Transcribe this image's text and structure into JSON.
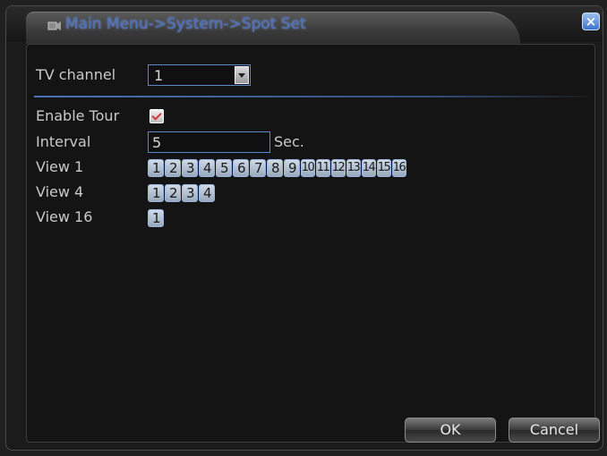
{
  "window": {
    "title": "Main Menu->System->Spot Set",
    "close_glyph": "×"
  },
  "form": {
    "tv_channel": {
      "label": "TV channel",
      "value": "1"
    },
    "enable_tour": {
      "label": "Enable Tour",
      "checked": true
    },
    "interval": {
      "label": "Interval",
      "value": "5",
      "unit": "Sec."
    },
    "view1": {
      "label": "View 1",
      "channels": [
        "1",
        "2",
        "3",
        "4",
        "5",
        "6",
        "7",
        "8",
        "9",
        "10",
        "11",
        "12",
        "13",
        "14",
        "15",
        "16"
      ]
    },
    "view4": {
      "label": "View 4",
      "channels": [
        "1",
        "2",
        "3",
        "4"
      ]
    },
    "view16": {
      "label": "View 16",
      "channels": [
        "1"
      ]
    }
  },
  "buttons": {
    "ok": "OK",
    "cancel": "Cancel"
  },
  "colors": {
    "accent": "#5b86c9",
    "title": "#4f6fb5",
    "check": "#d23a3a"
  },
  "icons": {
    "title": "settings-icon",
    "close": "close-icon",
    "dropdown": "chevron-down-icon"
  }
}
